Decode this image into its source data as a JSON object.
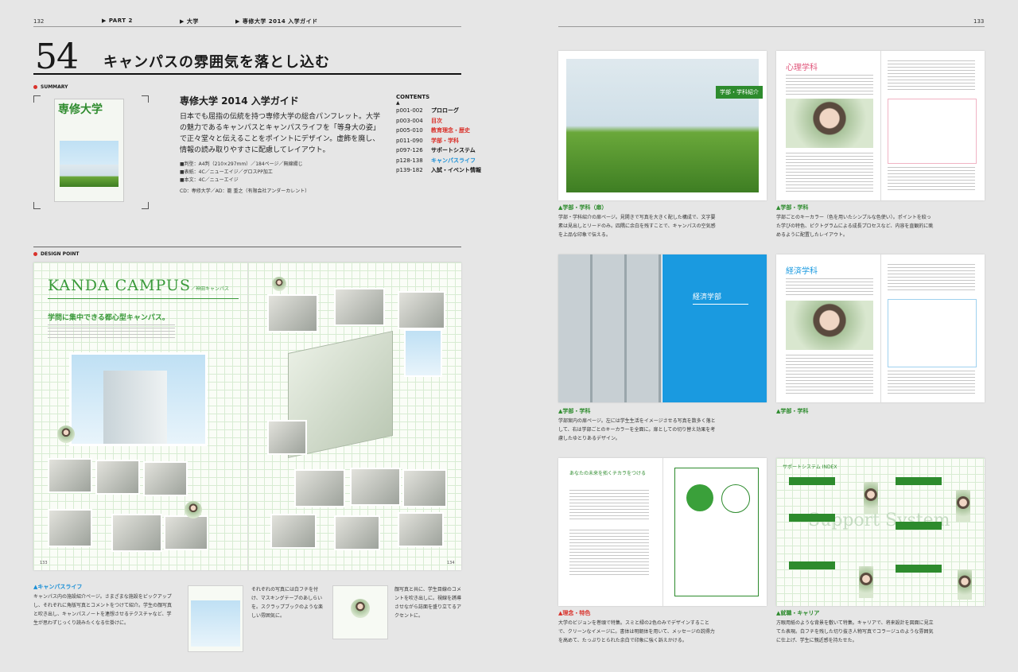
{
  "header": {
    "page_left": "132",
    "crumb1": "▶ PART 2",
    "crumb2": "▶ 大学",
    "crumb3": "▶ 専修大学 2014 入学ガイド",
    "page_right": "133"
  },
  "chapter": {
    "number": "54",
    "title": "キャンパスの雰囲気を落とし込む"
  },
  "summary": {
    "label": "SUMMARY",
    "cover_title": "専修大学",
    "title": "専修大学 2014 入学ガイド",
    "description": "日本でも屈指の伝統を持つ専修大学の総合パンフレット。大学の魅力であるキャンパスとキャンパスライフを「等身大の姿」で正々堂々と伝えることをポイントにデザイン。虚飾を廃し、情報の読み取りやすさに配慮してレイアウト。",
    "specs": [
      "■判型：A4判（210×297mm）／184ページ／無線綴じ",
      "■表紙：4C／ニューエイジ／グロスPP加工",
      "■本文：4C／ニューエイジ"
    ],
    "credits": "CD：専修大学／AD：籠 重之（有限会社アンダーカレント）"
  },
  "contents": {
    "label": "CONTENTS",
    "items": [
      {
        "pages": "p001-002",
        "title": "プロローグ",
        "color": "#111111"
      },
      {
        "pages": "p003-004",
        "title": "目次",
        "color": "#d9322b"
      },
      {
        "pages": "p005-010",
        "title": "教育理念・歴史",
        "color": "#d9322b"
      },
      {
        "pages": "p011-090",
        "title": "学部・学科",
        "color": "#d9322b"
      },
      {
        "pages": "p097-126",
        "title": "サポートシステム",
        "color": "#111111"
      },
      {
        "pages": "p128-138",
        "title": "キャンパスライフ",
        "color": "#1a8fd6"
      },
      {
        "pages": "p139-182",
        "title": "入試・イベント情報",
        "color": "#111111"
      }
    ]
  },
  "design_point": {
    "label": "DESIGN POINT",
    "spread_title": "KANDA CAMPUS",
    "spread_subtitle": "／神田キャンパス",
    "spread_heading": "学問に集中できる都心型キャンパス。",
    "page_left_no": "133",
    "page_right_no": "134",
    "caption_title": "▲キャンパスライフ",
    "caption_text": "キャンパス内の施設紹介ページ。さまざまな施設をピックアップし、それぞれに角版写真とコメントをつけて紹介。学生の顔写真と吹き出し、キャンパスノートを連想させるテクスチャなど、学生が思わずじっくり読みたくなる仕掛けに。",
    "note1": "それぞれの写真には白フチを付け、マスキングテープのあしらいを。スクラップブックのような楽しい雰囲気に。",
    "note2": "顔写真と共に、学生目線のコメントを吹き出しに。視線を誘導させながら誌面を盛り立てるアクセントに。"
  },
  "samples": [
    {
      "caption_title": "▲学部・学科（扉）",
      "caption_text": "学部・学科紹介の扉ページ。見開きで写真を大きく配した構成で、文字要素は見出しとリードのみ。四隅に余白を残すことで、キャンパスの空気感を上品な印象で伝える。",
      "badge": "学部・学科紹介"
    },
    {
      "caption_title": "▲学部・学科",
      "caption_text": "学部ごとのキーカラー（色を用いたシンプルな色使い）。ポイントを絞った学びの特色、ピクトグラムによる成長プロセスなど、内容を直観的に眺めるように配置したレイアウト。",
      "heading": "心理学科"
    },
    {
      "caption_title": "▲学部・学科",
      "caption_text": "学部案内の扉ページ。左には学生生活をイメージさせる写真を数多く落として、右は学部ごとのキーカラーを全面に。扉としての切り替え効果を考慮したゆとりあるデザイン。",
      "heading": "経済学部"
    },
    {
      "caption_title": "▲学部・学科",
      "caption_text": "",
      "heading": "経済学科"
    },
    {
      "caption_title": "▲理念・特色",
      "caption_text": "大学のビジョンを巻頭で特集。スミと緑の2色のみでデザインすることで、クリーンなイメージに。書体は明朝体を用いて、メッセージの説得力を高めて、たっぷりとられた余白で印象に強く訴えかける。",
      "heading": "あなたの未来を拓くチカラをつける"
    },
    {
      "caption_title": "▲就職・キャリア",
      "caption_text": "方眼用紙のような背景を敷いて特集。キャリアで、将来設計を図面に見立てた表現。白フチを残した切り抜き人物写真でコラージュのような雰囲気に仕上げ、学生に親近感を持たせた。",
      "heading": "サポートシステム INDEX",
      "bg_text": "Support System"
    }
  ],
  "colors": {
    "accent_red": "#d9322b",
    "accent_green": "#2d8b2d",
    "accent_blue": "#1a8fd6"
  }
}
